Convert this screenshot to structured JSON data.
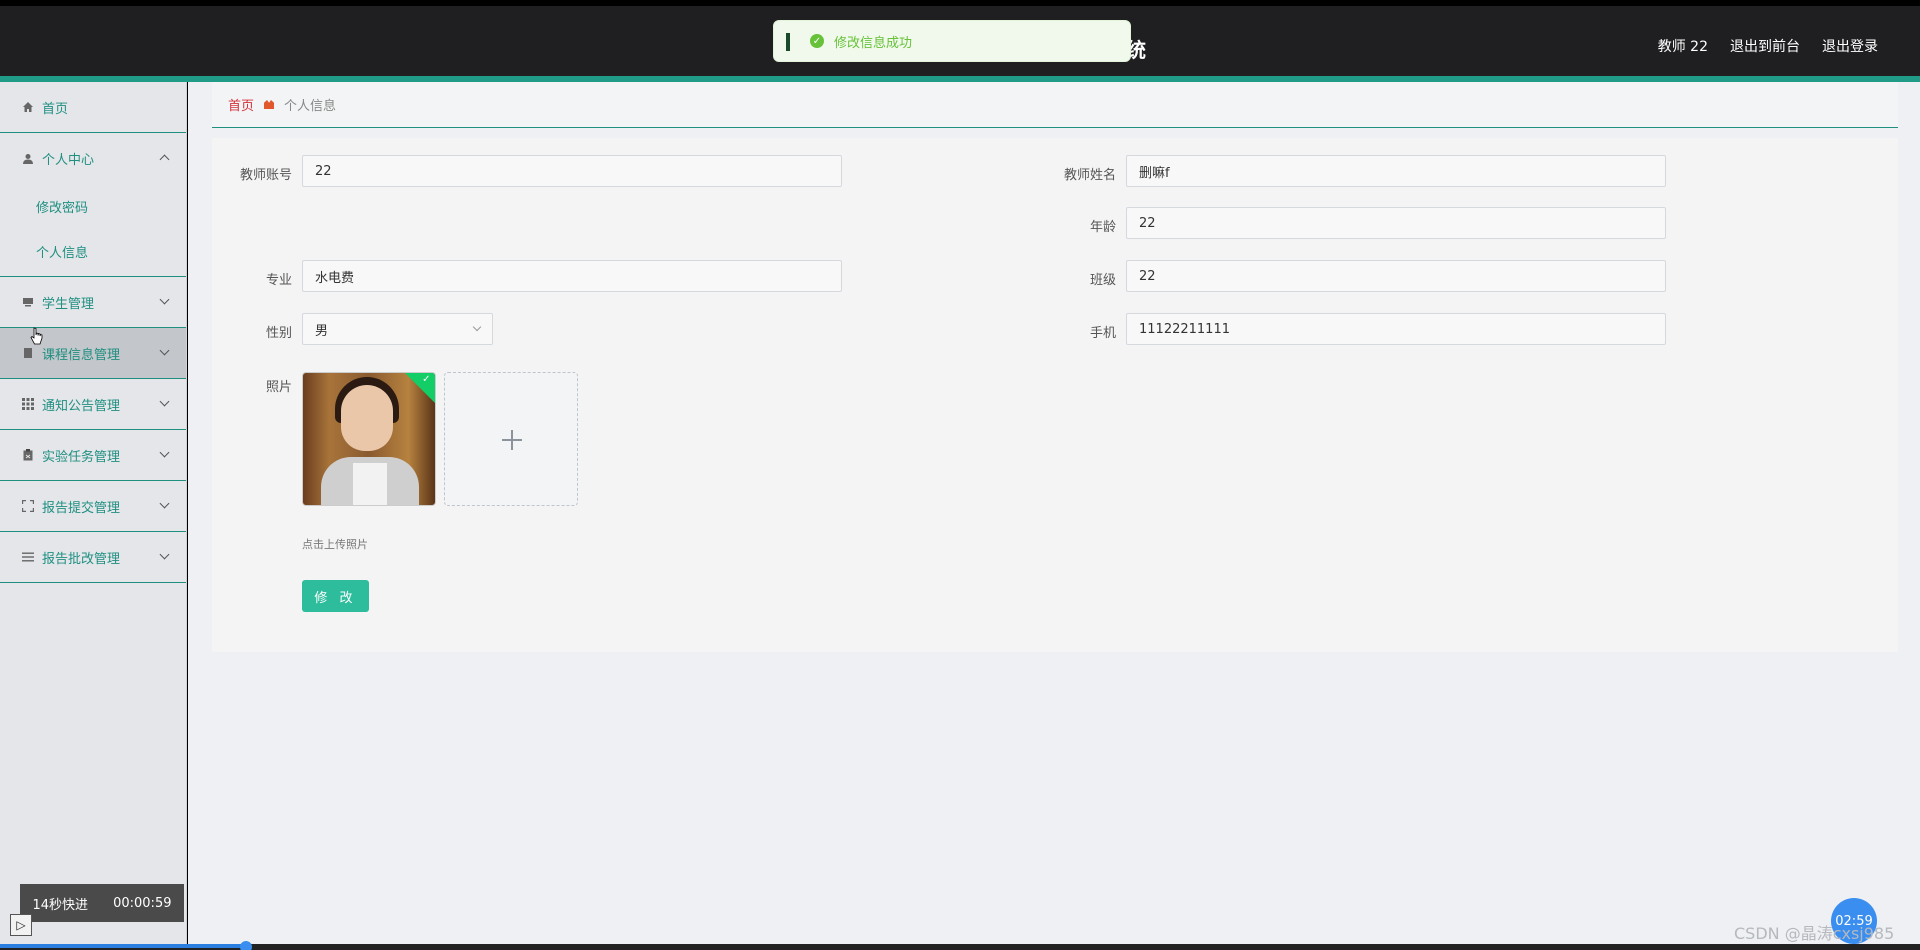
{
  "header": {
    "title_fragment": "统",
    "links": [
      "教师 22",
      "退出到前台",
      "退出登录"
    ]
  },
  "toast": {
    "message": "修改信息成功"
  },
  "sidebar": {
    "items": [
      {
        "label": "首页",
        "icon": "home-icon"
      },
      {
        "label": "个人中心",
        "icon": "user-icon",
        "expanded": true,
        "children": [
          "修改密码",
          "个人信息"
        ]
      },
      {
        "label": "学生管理",
        "icon": "monitor-icon"
      },
      {
        "label": "课程信息管理",
        "icon": "document-icon"
      },
      {
        "label": "通知公告管理",
        "icon": "grid-icon"
      },
      {
        "label": "实验任务管理",
        "icon": "clipboard-icon"
      },
      {
        "label": "报告提交管理",
        "icon": "fullscreen-icon"
      },
      {
        "label": "报告批改管理",
        "icon": "list-icon"
      }
    ]
  },
  "breadcrumb": {
    "home": "首页",
    "current": "个人信息"
  },
  "form": {
    "account_label": "教师账号",
    "account_value": "22",
    "name_label": "教师姓名",
    "name_value": "删嘛f",
    "age_label": "年龄",
    "age_value": "22",
    "major_label": "专业",
    "major_value": "水电费",
    "class_label": "班级",
    "class_value": "22",
    "gender_label": "性别",
    "gender_value": "男",
    "phone_label": "手机",
    "phone_value": "11122211111",
    "photo_label": "照片",
    "upload_hint": "点击上传照片",
    "submit_label": "修 改"
  },
  "video": {
    "skip_label": "14秒快进",
    "elapsed": "00:00:59",
    "timer": "02:59"
  },
  "watermark": "CSDN @晶涛cxsj985",
  "colors": {
    "accent": "#1f8f80",
    "button": "#2ebd9c",
    "toast_text": "#67c23a"
  }
}
